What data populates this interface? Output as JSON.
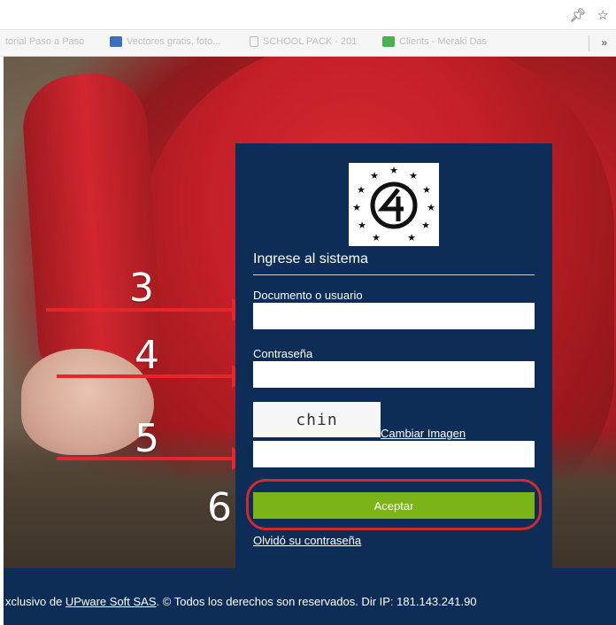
{
  "browser": {
    "bookmarks": [
      {
        "label": "torial Paso a Paso",
        "color": "#c7c7c7"
      },
      {
        "label": "Vectores gratis, foto...",
        "color": "#3b6fb6"
      },
      {
        "label": "SCHOOL PACK - 201",
        "color": "#bbbbbb"
      },
      {
        "label": "Clients - Meraki Das",
        "color": "#4caf50"
      }
    ],
    "more_label": "»"
  },
  "annotations": {
    "n3": "3",
    "n4": "4",
    "n5": "5",
    "n6": "6",
    "arrow_color": "#e8252b"
  },
  "login": {
    "title": "Ingrese al sistema",
    "user_label": "Documento o usuario",
    "password_label": "Contraseña",
    "captcha_text": "chin",
    "change_image_link": "Cambiar Imagen",
    "submit_label": "Aceptar",
    "forgot_link": "Olvidó su contraseña",
    "panel_color": "#0d2d57",
    "button_color": "#7ab417"
  },
  "footer": {
    "prefix": "xclusivo de ",
    "company_link": "UPware Soft SAS",
    "suffix": ". © Todos los derechos son reservados. Dir IP:  181.143.241.90"
  }
}
